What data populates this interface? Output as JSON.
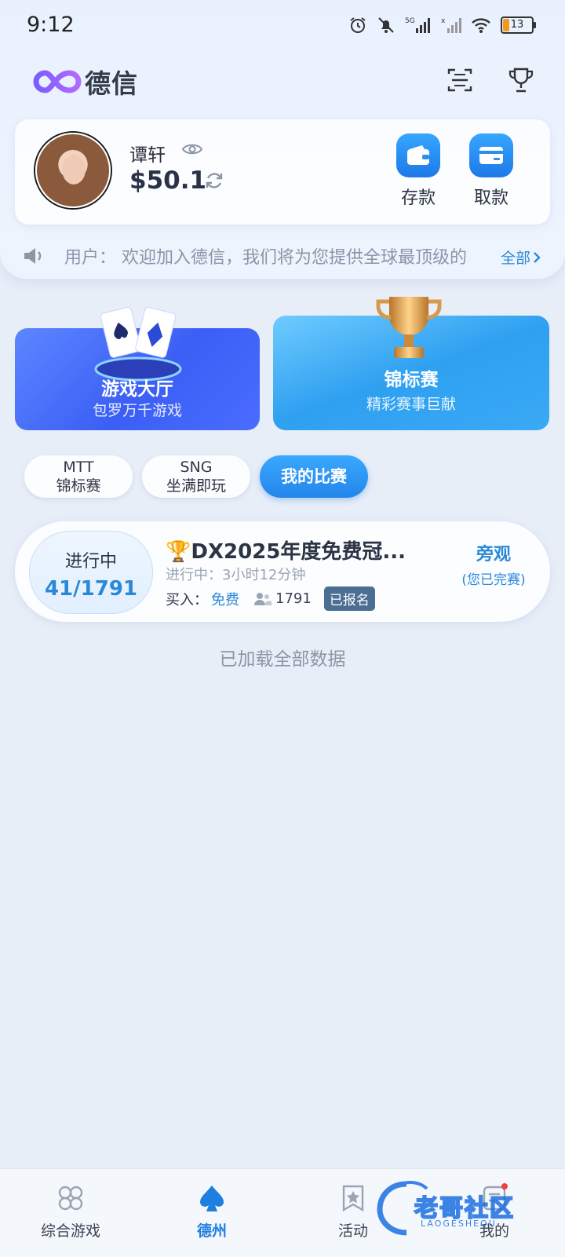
{
  "status_bar": {
    "time": "9:12",
    "battery": "13",
    "network": "5G"
  },
  "header": {
    "logo_text": "德信",
    "scan_icon": "scan-icon",
    "trophy_icon": "trophy-icon"
  },
  "account": {
    "username": "谭轩",
    "balance": "$50.1",
    "deposit_label": "存款",
    "withdraw_label": "取款"
  },
  "notice": {
    "text": "用户：  欢迎加入德信，我们将为您提供全球最顶级的",
    "all_label": "全部"
  },
  "banners": {
    "lobby": {
      "title": "游戏大厅",
      "subtitle": "包罗万千游戏"
    },
    "championship": {
      "title": "锦标赛",
      "subtitle": "精彩赛事巨献"
    }
  },
  "tabs": [
    {
      "line1": "MTT",
      "line2": "锦标赛"
    },
    {
      "line1": "SNG",
      "line2": "坐满即玩"
    },
    {
      "label": "我的比赛",
      "active": true
    }
  ],
  "match": {
    "status": "进行中",
    "progress": "41/1791",
    "title": "🏆DX2025年度免费冠...",
    "time_status": "进行中：3小时12分钟",
    "buyin_label": "买入：",
    "buyin_value": "免费",
    "players": "1791",
    "registered": "已报名",
    "watch_label": "旁观",
    "watch_note": "(您已完赛)"
  },
  "loaded_text": "已加载全部数据",
  "bottom_nav": [
    {
      "label": "综合游戏",
      "icon": "clover-icon"
    },
    {
      "label": "德州",
      "icon": "spade-icon",
      "active": true
    },
    {
      "label": "活动",
      "icon": "star-badge-icon"
    },
    {
      "label": "我的",
      "icon": "profile-icon"
    }
  ],
  "watermark": {
    "text": "老哥社区",
    "sub": "LAOGESHEQU"
  },
  "colors": {
    "accent": "#2286ea",
    "background": "#e8eef8",
    "registered_badge": "#4c6e92"
  }
}
